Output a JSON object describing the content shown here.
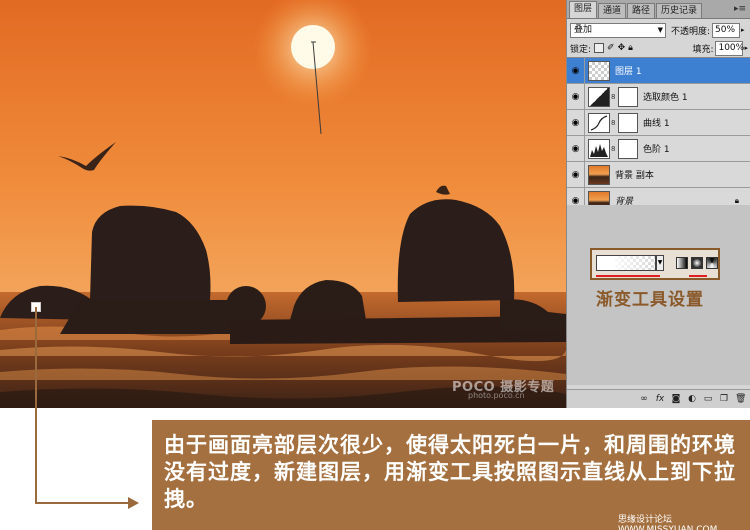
{
  "photo": {
    "watermark": "POCO 摄影专题",
    "watermark_url": "photo.poco.cn",
    "sky_top_color": "#e8762b",
    "sky_mid_color": "#f29a48",
    "sun_color": "#fffbe6"
  },
  "layers_panel": {
    "tabs": [
      {
        "label": "图层",
        "active": true
      },
      {
        "label": "通道",
        "active": false
      },
      {
        "label": "路径",
        "active": false
      },
      {
        "label": "历史记录",
        "active": false
      }
    ],
    "blend_mode": "叠加",
    "opacity_label": "不透明度:",
    "opacity_value": "50%",
    "lock_label": "锁定:",
    "fill_label": "填充:",
    "fill_value": "100%",
    "layers": [
      {
        "name": "图层 1",
        "selected": true,
        "thumb": "checker",
        "mask": false
      },
      {
        "name": "选取颜色 1",
        "selected": false,
        "thumb": "adjust",
        "mask": true
      },
      {
        "name": "曲线 1",
        "selected": false,
        "thumb": "curves",
        "mask": true
      },
      {
        "name": "色阶 1",
        "selected": false,
        "thumb": "levels",
        "mask": true
      },
      {
        "name": "背景 副本",
        "selected": false,
        "thumb": "photo",
        "mask": false
      },
      {
        "name": "背景",
        "selected": false,
        "thumb": "photo",
        "mask": false,
        "locked": true
      }
    ],
    "bottom_buttons": [
      "link-icon",
      "fx-icon",
      "mask-icon",
      "adjustment-icon",
      "folder-icon",
      "new-layer-icon",
      "trash-icon"
    ]
  },
  "gradient_tool": {
    "caption": "渐变工具设置",
    "types": [
      "linear",
      "radial",
      "angle"
    ],
    "highlight_color": "#e02020"
  },
  "annotation": {
    "text": "由于画面亮部层次很少，使得太阳死白一片，和周围的环境没有过度，新建图层，用渐变工具按照图示直线从上到下拉拽。",
    "accent_color": "#a5703f"
  },
  "site_mark": "思缘设计论坛 WWW.MISSYUAN.COM"
}
